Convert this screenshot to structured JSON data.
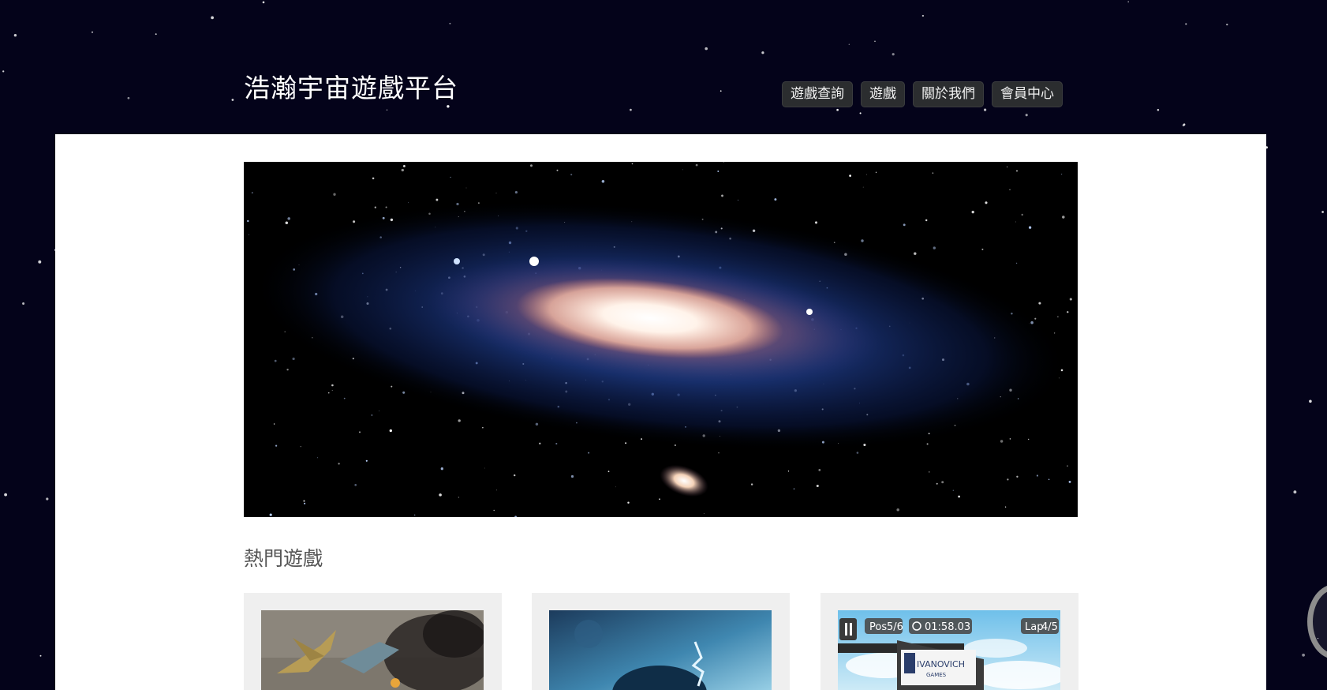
{
  "header": {
    "site_title": "浩瀚宇宙遊戲平台"
  },
  "nav": {
    "items": [
      "遊戲查詢",
      "遊戲",
      "關於我們",
      "會員中心"
    ]
  },
  "hero": {
    "alt": "galaxy banner"
  },
  "section": {
    "popular_title": "熱門遊戲"
  },
  "games": [
    {
      "alt": "jet fighter game"
    },
    {
      "alt": "underwater game"
    },
    {
      "alt": "racing game",
      "hud_pos_label": "Pos",
      "hud_pos_value": "5/6",
      "hud_time": "01:58.03",
      "hud_lap_label": "Lap",
      "hud_lap_value": "4/5",
      "sign_brand": "IVANOVICH",
      "sign_sub": "GAMES"
    }
  ],
  "colors": {
    "space_bg": "#04031a",
    "panel_bg": "#ffffff",
    "nav_bg": "#2b2d2f",
    "card_bg": "#efefef"
  }
}
